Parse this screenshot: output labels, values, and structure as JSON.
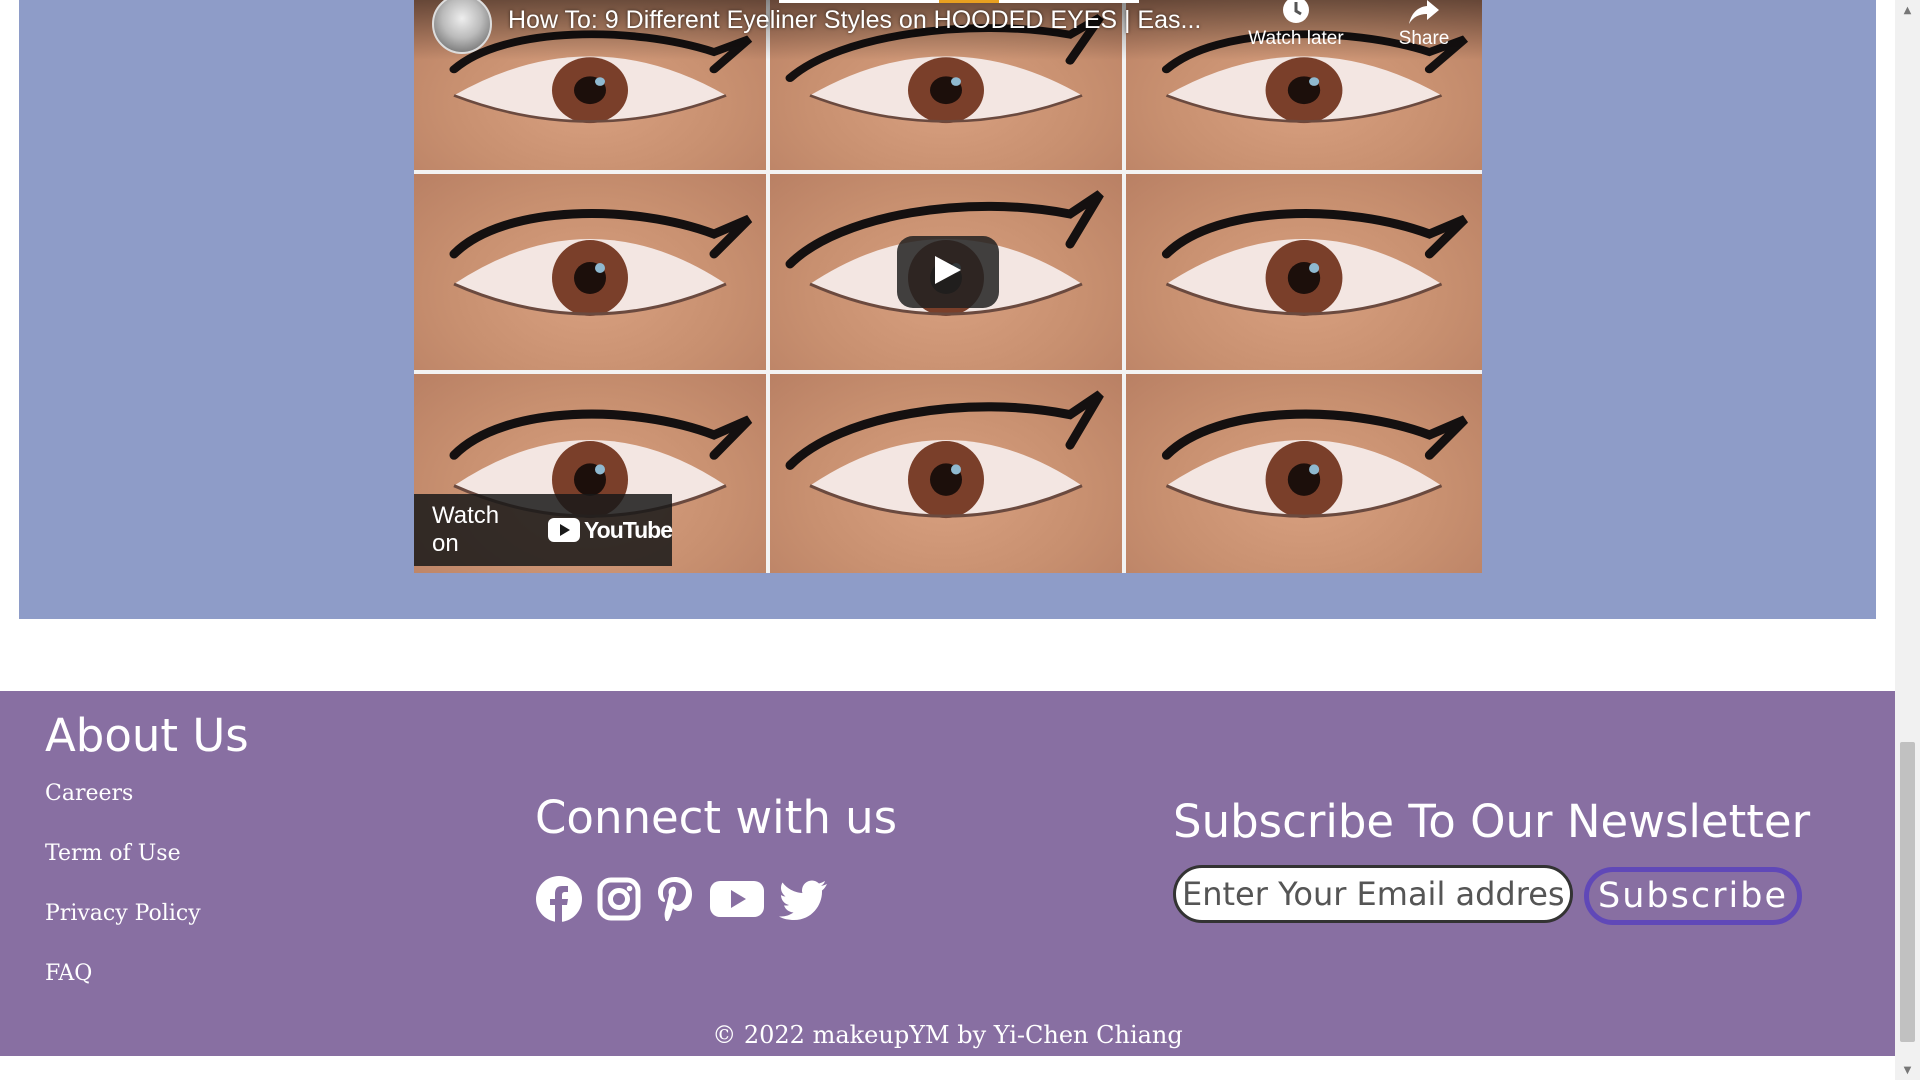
{
  "video": {
    "title": "How To: 9 Different Eyeliner Styles on HOODED EYES | Eas...",
    "watch_later_label": "Watch later",
    "share_label": "Share",
    "watch_on_label": "Watch on",
    "youtube_word": "YouTube",
    "thumbnail_tiles": 9
  },
  "footer": {
    "about": {
      "heading": "About Us",
      "links": [
        "Careers",
        "Term of Use",
        "Privacy Policy",
        "FAQ"
      ]
    },
    "connect": {
      "heading": "Connect with us",
      "icons": [
        "facebook-icon",
        "instagram-icon",
        "pinterest-icon",
        "youtube-icon",
        "twitter-icon"
      ]
    },
    "newsletter": {
      "heading": "Subscribe To Our Newsletter",
      "email_placeholder": "Enter Your Email address",
      "email_value": "",
      "subscribe_label": "Subscribe"
    },
    "copyright": "© 2022 makeupYM by Yi-Chen Chiang"
  },
  "colors": {
    "video_section_bg": "#8e9cc8",
    "footer_bg": "#886fa2",
    "subscribe_border": "#6048b8",
    "youtube_red": "#ff0000"
  }
}
